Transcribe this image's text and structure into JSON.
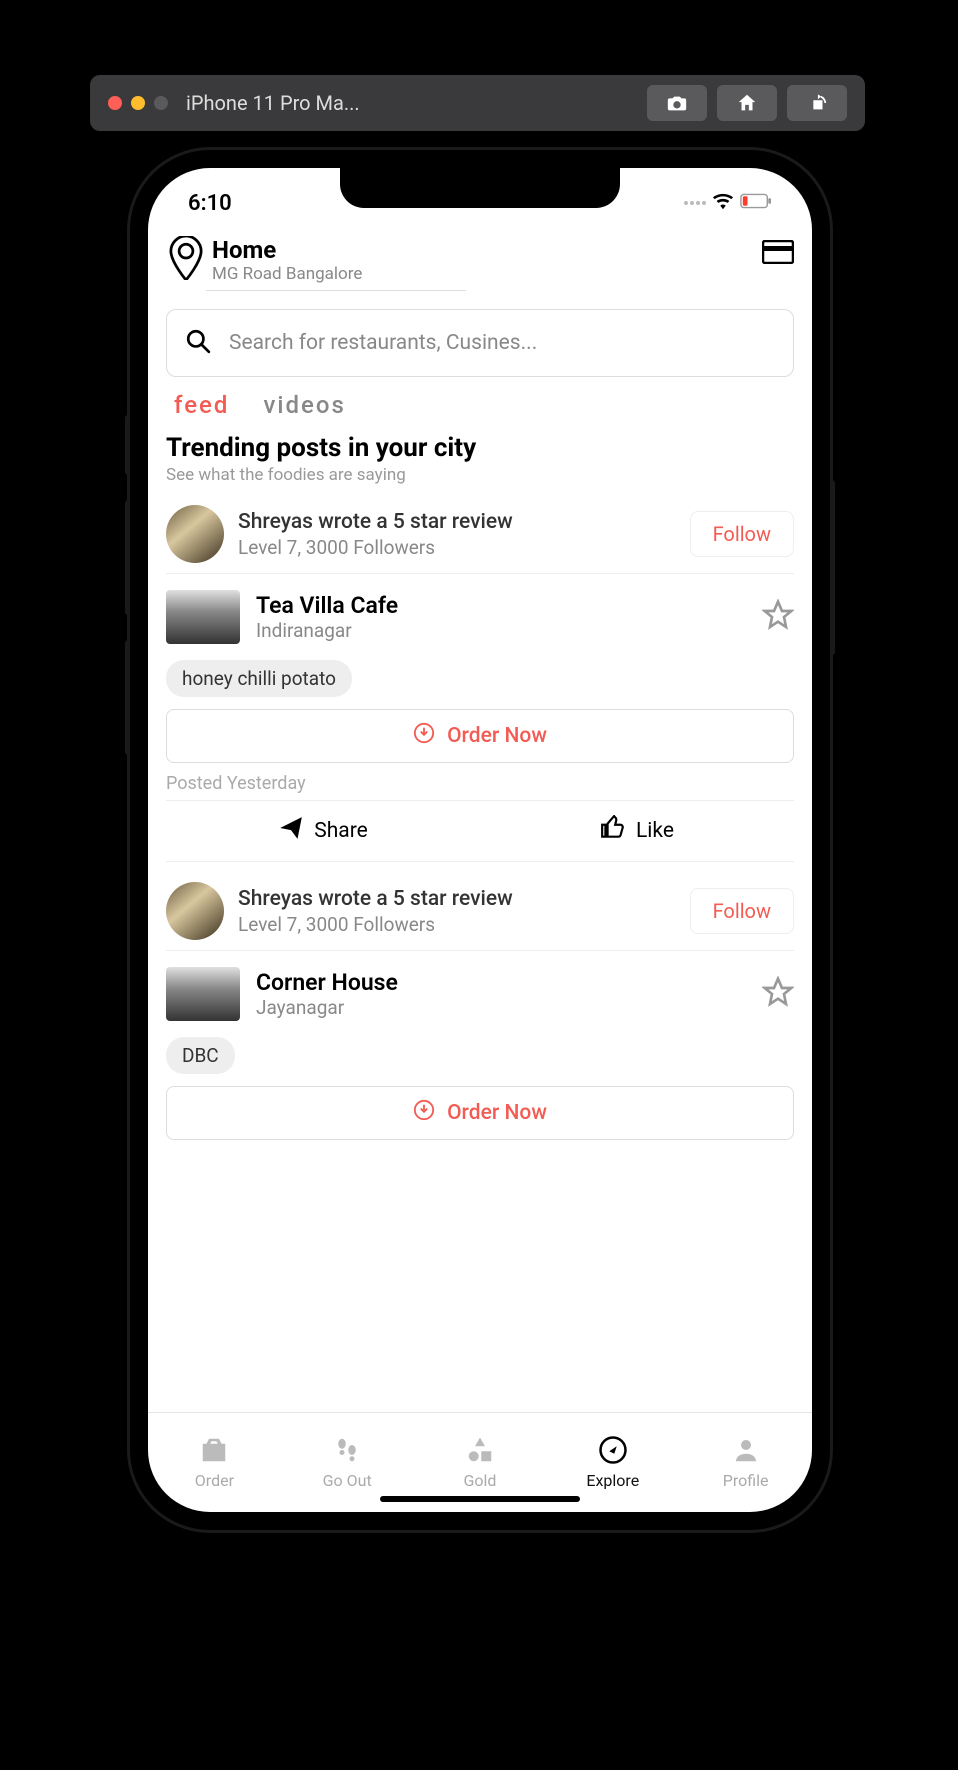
{
  "titlebar": {
    "title": "iPhone 11 Pro Ma..."
  },
  "statusbar": {
    "time": "6:10"
  },
  "header": {
    "location_title": "Home",
    "location_sub": "MG Road Bangalore"
  },
  "search": {
    "placeholder": "Search for restaurants, Cusines..."
  },
  "tabs": {
    "feed": "feed",
    "videos": "videos"
  },
  "trending": {
    "title": "Trending posts in your city",
    "sub": "See what the foodies are saying"
  },
  "posts": [
    {
      "user_title": "Shreyas wrote a 5 star review",
      "user_sub": "Level 7, 3000 Followers",
      "follow": "Follow",
      "restaurant": "Tea Villa Cafe",
      "rest_sub": "Indiranagar",
      "tag": "honey chilli potato",
      "order": "Order Now",
      "posted": "Posted Yesterday",
      "share": "Share",
      "like": "Like"
    },
    {
      "user_title": "Shreyas wrote a 5 star review",
      "user_sub": "Level 7, 3000 Followers",
      "follow": "Follow",
      "restaurant": "Corner House",
      "rest_sub": "Jayanagar",
      "tag": "DBC",
      "order": "Order Now"
    }
  ],
  "nav": {
    "order": "Order",
    "goout": "Go Out",
    "gold": "Gold",
    "explore": "Explore",
    "profile": "Profile"
  }
}
